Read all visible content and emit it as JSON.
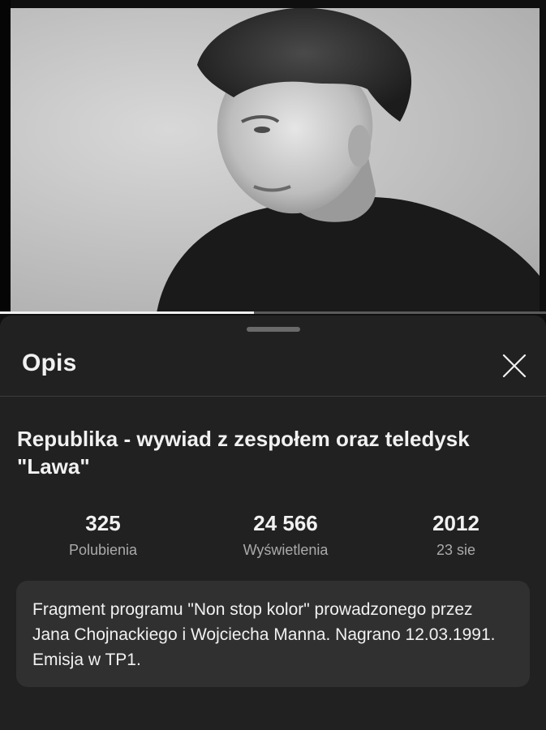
{
  "player": {
    "progress_fraction": 0.465
  },
  "sheet": {
    "title": "Opis",
    "close_icon": "close-icon"
  },
  "video": {
    "title": "Republika - wywiad z zespołem oraz teledysk \"Lawa\"",
    "stats": [
      {
        "value": "325",
        "label": "Polubienia"
      },
      {
        "value": "24 566",
        "label": "Wyświetlenia"
      },
      {
        "value": "2012",
        "label": "23 sie"
      }
    ],
    "description": "Fragment programu \"Non stop kolor\" prowadzonego przez Jana Chojnackiego i Wojciecha Manna. Nagrano 12.03.1991. Emisja w TP1."
  },
  "colors": {
    "background": "#0f0f0f",
    "sheet": "#212121",
    "description_box": "#303030",
    "secondary_text": "#aaaaaa"
  }
}
